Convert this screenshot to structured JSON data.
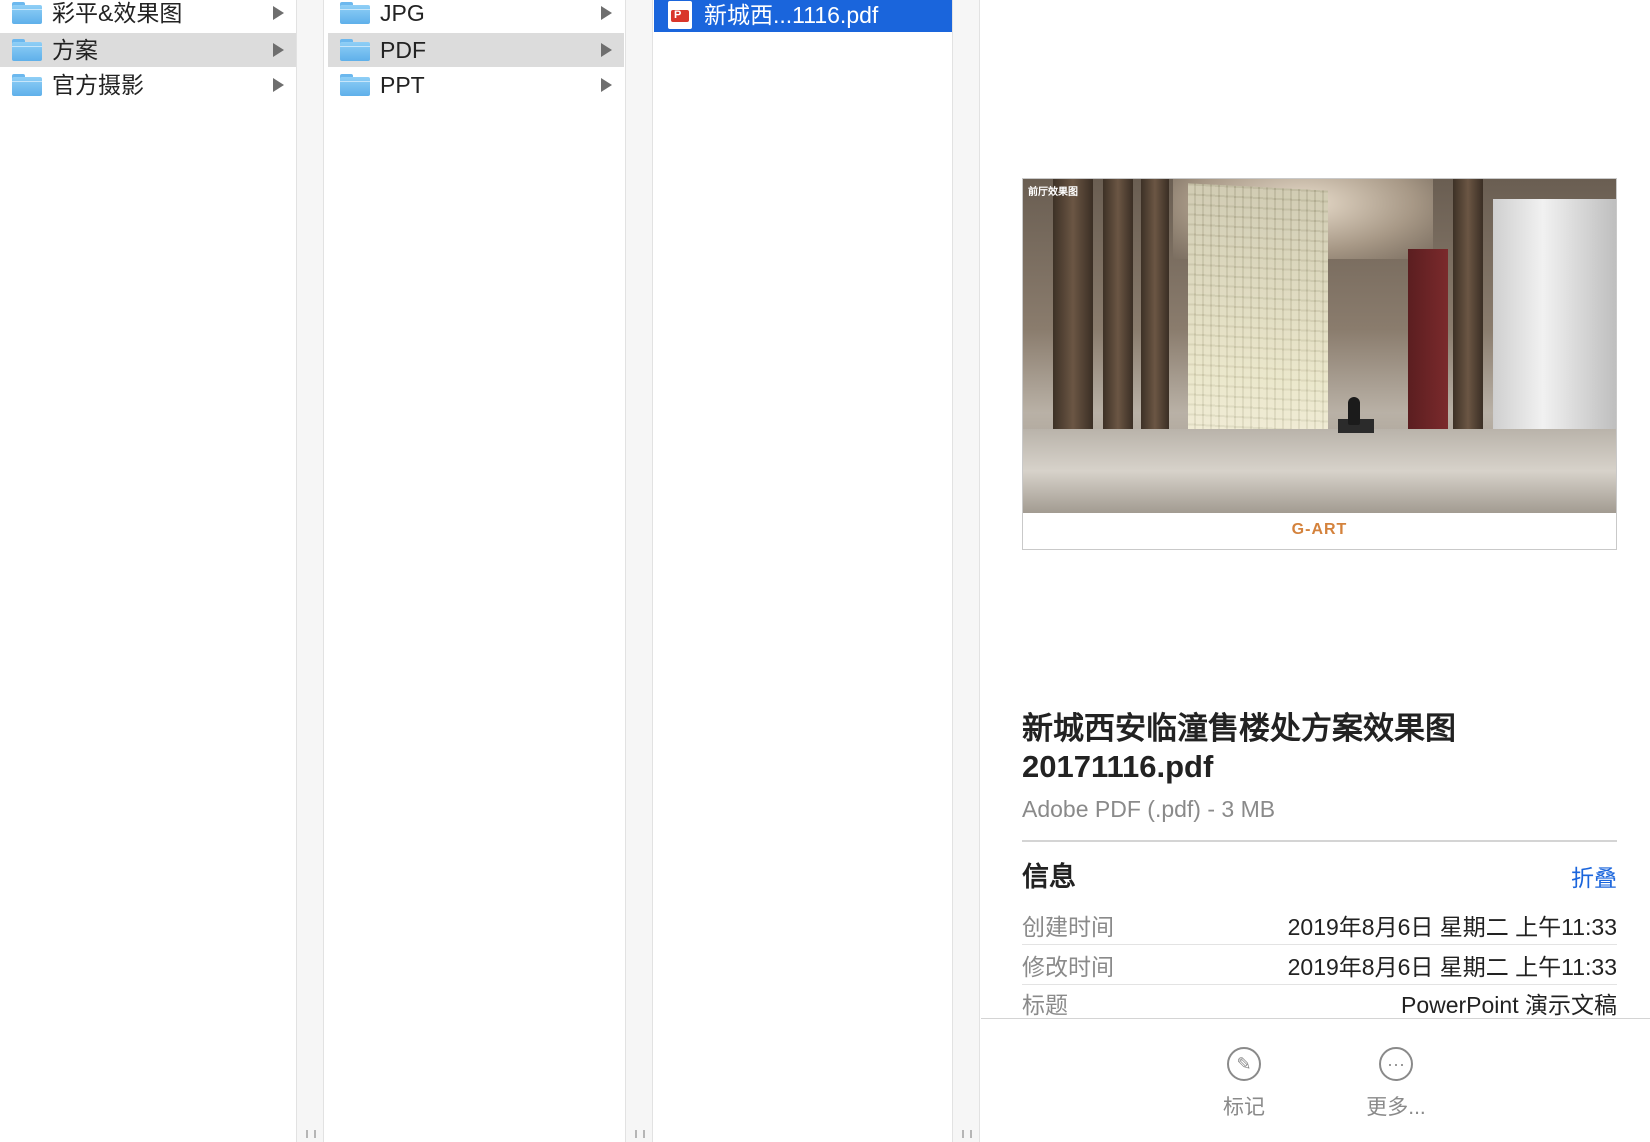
{
  "column1": {
    "items": [
      {
        "label": "彩平&效果图",
        "selected": false
      },
      {
        "label": "方案",
        "selected": true
      },
      {
        "label": "官方摄影",
        "selected": false
      }
    ]
  },
  "column2": {
    "items": [
      {
        "label": "JPG",
        "selected": false
      },
      {
        "label": "PDF",
        "selected": true
      },
      {
        "label": "PPT",
        "selected": false
      }
    ]
  },
  "column3": {
    "items": [
      {
        "label": "新城西...1116.pdf",
        "selected": true
      }
    ]
  },
  "preview": {
    "thumbnail": {
      "caption": "前厅效果图",
      "logo": "G-ART"
    },
    "file_name": "新城西安临潼售楼处方案效果图20171116.pdf",
    "kind_size": "Adobe PDF (.pdf) - 3 MB",
    "info": {
      "title": "信息",
      "collapse_label": "折叠",
      "rows": [
        {
          "key": "创建时间",
          "value": "2019年8月6日 星期二 上午11:33"
        },
        {
          "key": "修改时间",
          "value": "2019年8月6日 星期二 上午11:33"
        },
        {
          "key": "标题",
          "value": "PowerPoint 演示文稿"
        }
      ]
    },
    "actions": [
      {
        "label": "标记",
        "icon": "markup-icon"
      },
      {
        "label": "更多...",
        "icon": "more-icon"
      }
    ]
  },
  "colors": {
    "selection_blue": "#1a65dc",
    "selection_grey": "#dcdcdc",
    "link_blue": "#1a65dc"
  }
}
